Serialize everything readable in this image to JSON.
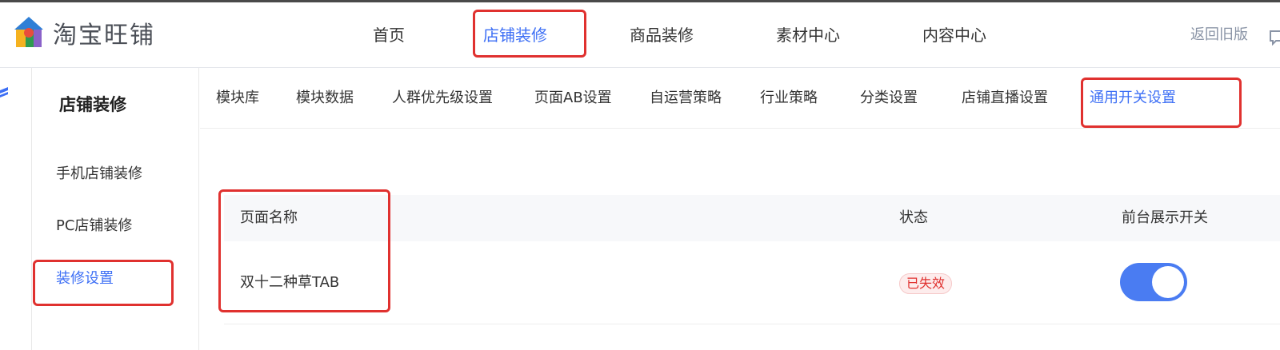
{
  "logo": {
    "text": "淘宝旺铺"
  },
  "nav": {
    "items": [
      {
        "label": "首页"
      },
      {
        "label": "店铺装修"
      },
      {
        "label": "商品装修"
      },
      {
        "label": "素材中心"
      },
      {
        "label": "内容中心"
      }
    ],
    "active_index": 1,
    "back_old": "返回旧版"
  },
  "sidebar": {
    "title": "店铺装修",
    "items": [
      {
        "label": "手机店铺装修"
      },
      {
        "label": "PC店铺装修"
      },
      {
        "label": "装修设置"
      }
    ],
    "active_index": 2
  },
  "tabs": {
    "items": [
      {
        "label": "模块库"
      },
      {
        "label": "模块数据"
      },
      {
        "label": "人群优先级设置"
      },
      {
        "label": "页面AB设置"
      },
      {
        "label": "自运营策略"
      },
      {
        "label": "行业策略"
      },
      {
        "label": "分类设置"
      },
      {
        "label": "店铺直播设置"
      },
      {
        "label": "通用开关设置"
      }
    ],
    "active_index": 8
  },
  "table": {
    "columns": {
      "name": "页面名称",
      "status": "状态",
      "switch": "前台展示开关"
    },
    "rows": [
      {
        "name": "双十二种草TAB",
        "status": "已失效",
        "switch_on": true
      }
    ]
  },
  "colors": {
    "accent": "#3d6ff5",
    "toggle_on": "#4a7cf2",
    "annotation": "#e0312f",
    "badge_text": "#e0312f",
    "badge_bg": "#fdecec"
  }
}
